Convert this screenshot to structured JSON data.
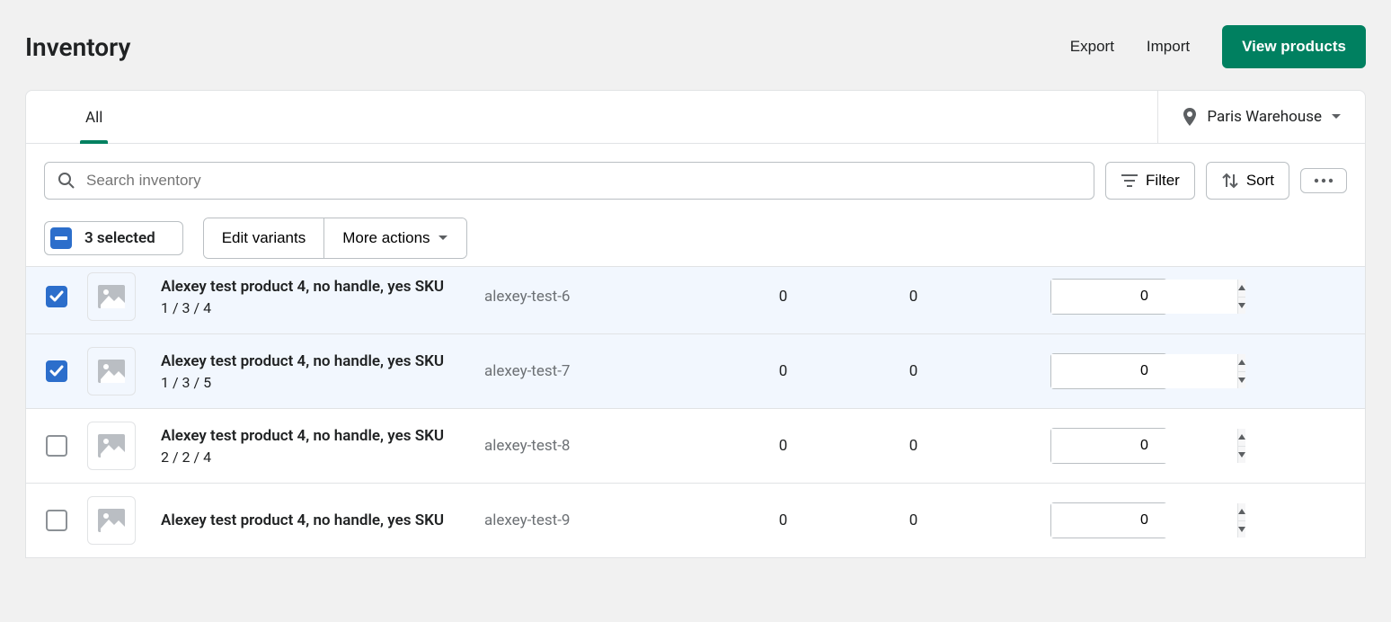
{
  "header": {
    "title": "Inventory",
    "export_label": "Export",
    "import_label": "Import",
    "view_products_label": "View products"
  },
  "tabs": {
    "all": "All"
  },
  "location": {
    "name": "Paris Warehouse"
  },
  "search": {
    "placeholder": "Search inventory"
  },
  "toolbar": {
    "filter_label": "Filter",
    "sort_label": "Sort"
  },
  "bulk": {
    "selected_count": "3 selected",
    "edit_variants_label": "Edit variants",
    "more_actions_label": "More actions"
  },
  "rows": [
    {
      "title": "Alexey test product 4, no handle, yes SKU",
      "variant": "1 / 3 / 4",
      "sku": "alexey-test-6",
      "num1": "0",
      "num2": "0",
      "qty": "0",
      "selected": true
    },
    {
      "title": "Alexey test product 4, no handle, yes SKU",
      "variant": "1 / 3 / 5",
      "sku": "alexey-test-7",
      "num1": "0",
      "num2": "0",
      "qty": "0",
      "selected": true
    },
    {
      "title": "Alexey test product 4, no handle, yes SKU",
      "variant": "2 / 2 / 4",
      "sku": "alexey-test-8",
      "num1": "0",
      "num2": "0",
      "qty": "0",
      "selected": false
    },
    {
      "title": "Alexey test product 4, no handle, yes SKU",
      "variant": "",
      "sku": "alexey-test-9",
      "num1": "0",
      "num2": "0",
      "qty": "0",
      "selected": false
    }
  ]
}
